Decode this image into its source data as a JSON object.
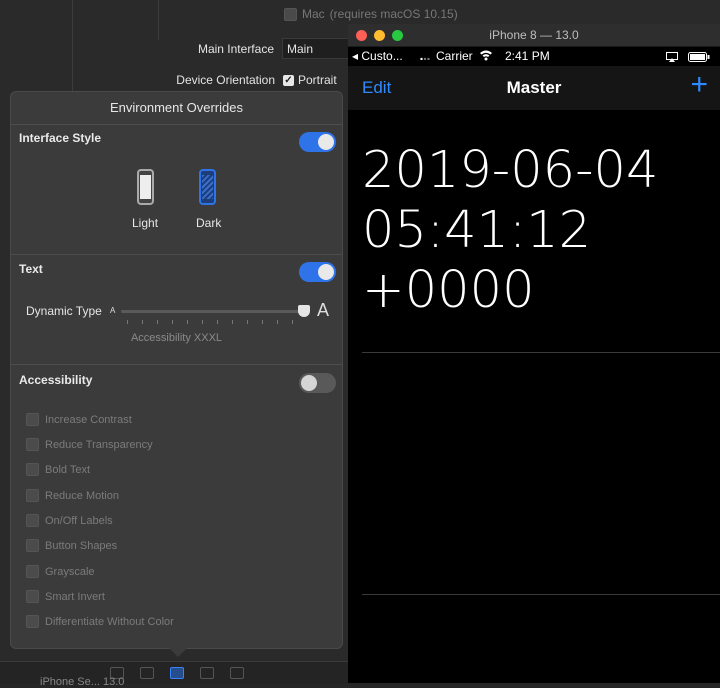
{
  "inspector": {
    "mac_label": "Mac",
    "mac_note": "(requires macOS 10.15)",
    "main_interface_label": "Main Interface",
    "main_interface_value": "Main",
    "device_orientation_label": "Device Orientation",
    "portrait_label": "Portrait",
    "bottom_text": "iPhone Se... 13.0"
  },
  "overrides": {
    "title": "Environment Overrides",
    "interface_style": {
      "label": "Interface Style",
      "enabled": true,
      "light_label": "Light",
      "dark_label": "Dark",
      "selected": "Dark"
    },
    "text": {
      "label": "Text",
      "enabled": true,
      "dynamic_type_label": "Dynamic Type",
      "small_a": "A",
      "large_a": "A",
      "dynamic_type_value": "Accessibility XXXL"
    },
    "accessibility": {
      "label": "Accessibility",
      "enabled": false,
      "items": [
        "Increase Contrast",
        "Reduce Transparency",
        "Bold Text",
        "Reduce Motion",
        "On/Off Labels",
        "Button Shapes",
        "Grayscale",
        "Smart Invert",
        "Differentiate Without Color"
      ]
    }
  },
  "simulator": {
    "window_title": "iPhone 8 — 13.0",
    "status": {
      "back_app": "◂ Custo...",
      "carrier": "Carrier",
      "time": "2:41 PM"
    },
    "nav": {
      "left": "Edit",
      "title": "Master",
      "right": "+"
    },
    "cell_lines": [
      "2019-06-04",
      "05:41:12",
      "+0000"
    ]
  },
  "colors": {
    "accent": "#2f73e8",
    "ios_blue": "#2f8bfd",
    "close": "#fe5f57",
    "minimize": "#febc2e",
    "zoom": "#28c840"
  }
}
